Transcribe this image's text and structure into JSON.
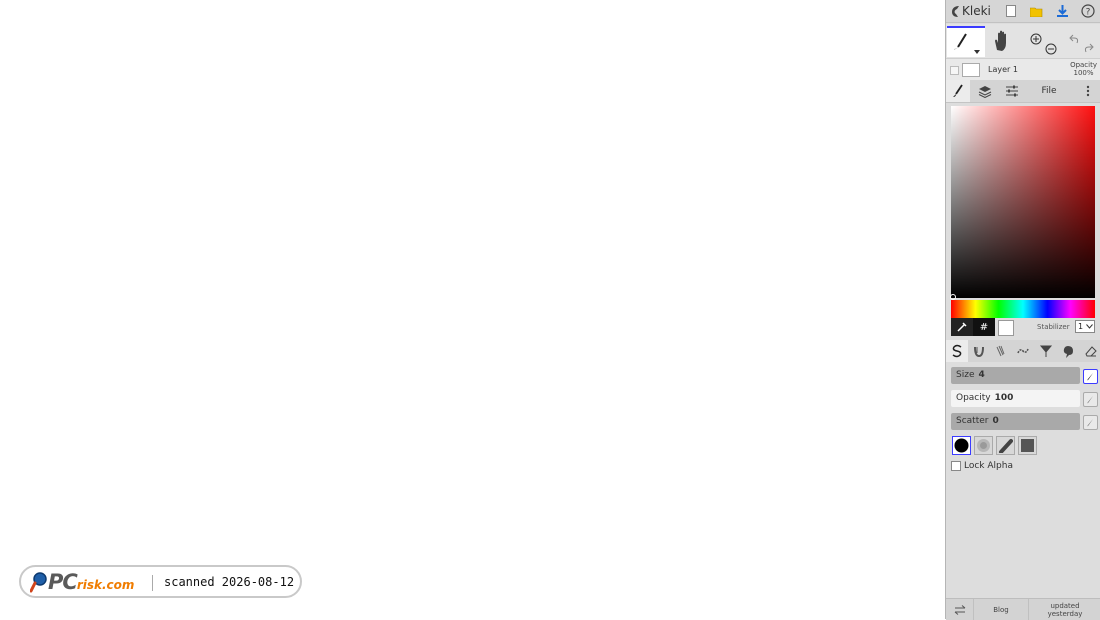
{
  "app": {
    "title": "Kleki"
  },
  "layers": {
    "name": "Layer 1",
    "opacity_label": "Opacity",
    "opacity_value": "100%"
  },
  "tabs": {
    "file_label": "File"
  },
  "color": {
    "hex_symbol": "#",
    "current": "#ffffff"
  },
  "stabilizer": {
    "label": "Stabilizer",
    "value": "1"
  },
  "brush": {
    "size_label": "Size",
    "size_value": "4",
    "opacity_label": "Opacity",
    "opacity_value": "100",
    "scatter_label": "Scatter",
    "scatter_value": "0"
  },
  "lock_alpha_label": "Lock Alpha",
  "footer": {
    "blog_label": "Blog",
    "updated_label": "updated",
    "updated_when": "yesterday"
  },
  "watermark": {
    "brand_pc": "PC",
    "brand_risk": "risk.com",
    "text": "scanned 2026-08-12"
  }
}
